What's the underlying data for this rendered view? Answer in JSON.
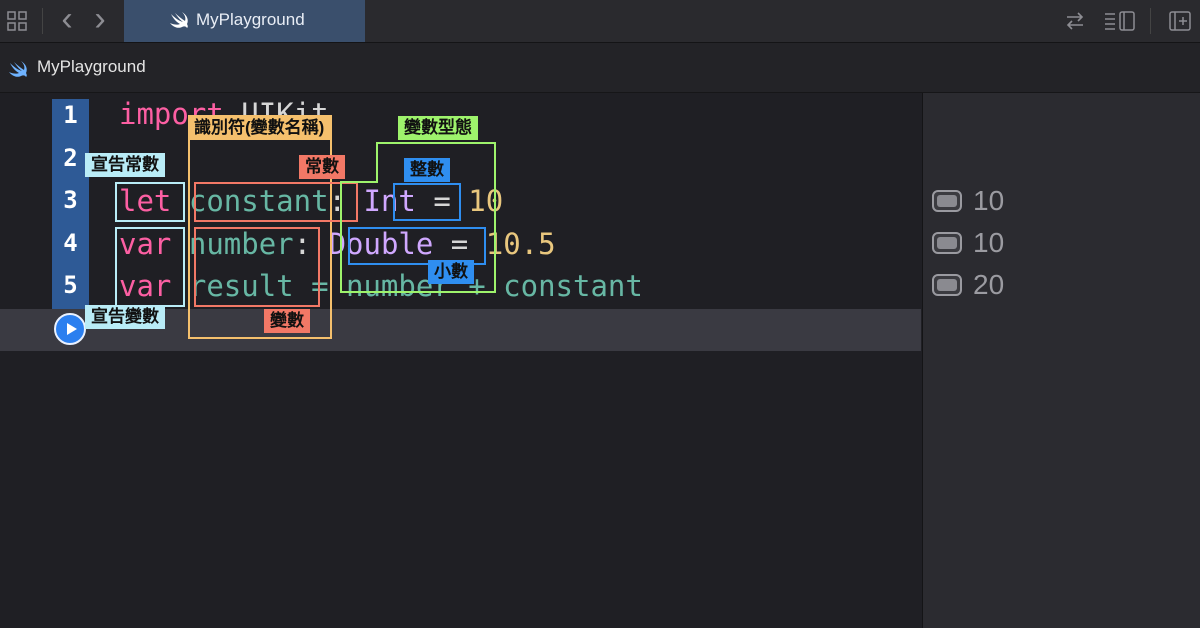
{
  "toolbar": {
    "tab_title": "MyPlayground",
    "back_glyph": "‹",
    "forward_glyph": "›",
    "icons": [
      "grid-icon",
      "back-icon",
      "forward-icon",
      "swift-icon",
      "swap-icon",
      "inspector-icon",
      "add-panel-icon"
    ]
  },
  "jumpbar": {
    "crumb": "MyPlayground"
  },
  "gutter": {
    "line_numbers": [
      "1",
      "2",
      "3",
      "4",
      "5"
    ]
  },
  "code": {
    "line1": {
      "kw": "import",
      "module": "UIKit"
    },
    "line3": {
      "kw": "let",
      "name": "constant",
      "colon": ":",
      "type": "Int",
      "eq": "=",
      "value": "10"
    },
    "line4": {
      "kw": "var",
      "name": "number",
      "colon": ":",
      "type": "Double",
      "eq": "=",
      "value": "10.5"
    },
    "line5": {
      "kw": "var",
      "name": "result",
      "expr": "= number + constant"
    }
  },
  "results": [
    "10",
    "10",
    "20"
  ],
  "annotations": {
    "identifier": "識別符(變數名稱)",
    "var_type": "變數型態",
    "declare_const": "宣告常數",
    "declare_var": "宣告變數",
    "constant": "常數",
    "variable": "變數",
    "integer": "整數",
    "decimal": "小數"
  },
  "colors": {
    "accent_blue": "#2b7fef",
    "keyword": "#fc5fa3",
    "identifier": "#67b7a4",
    "type": "#d0a8ff",
    "number": "#e9c77e",
    "annot_orange": "#f5c06d",
    "annot_green": "#9ef36c",
    "annot_red": "#f27866",
    "annot_blue": "#2f8ef0",
    "annot_cyan": "#b9ecf7"
  }
}
